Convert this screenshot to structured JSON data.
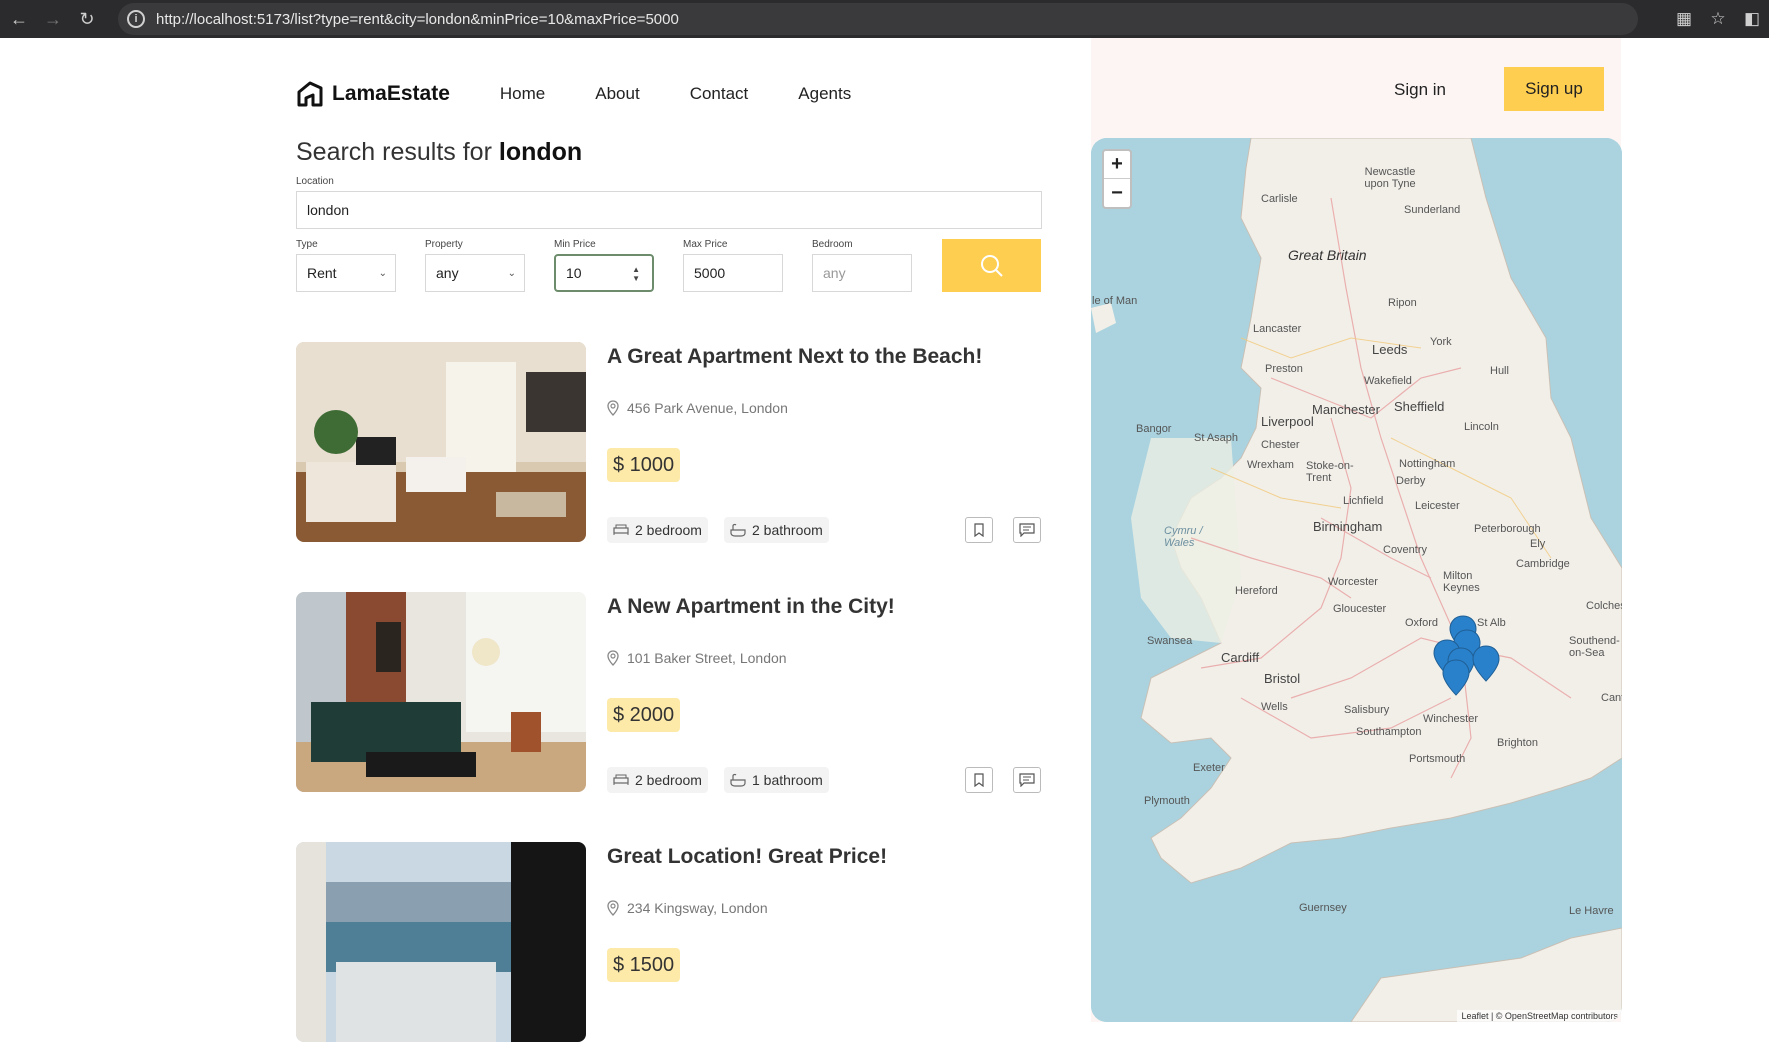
{
  "browser": {
    "url": "http://localhost:5173/list?type=rent&city=london&minPrice=10&maxPrice=5000"
  },
  "nav": {
    "brand": "LamaEstate",
    "links": [
      "Home",
      "About",
      "Contact",
      "Agents"
    ],
    "signin": "Sign in",
    "signup": "Sign up"
  },
  "search": {
    "title_prefix": "Search results for",
    "title_city": "london",
    "location_label": "Location",
    "location_value": "london",
    "type_label": "Type",
    "type_value": "Rent",
    "property_label": "Property",
    "property_value": "any",
    "min_label": "Min Price",
    "min_value": "10",
    "max_label": "Max Price",
    "max_value": "5000",
    "bedroom_label": "Bedroom",
    "bedroom_placeholder": "any"
  },
  "listings": [
    {
      "title": "A Great Apartment Next to the Beach!",
      "address": "456 Park Avenue, London",
      "price": "$ 1000",
      "bedroom": "2 bedroom",
      "bathroom": "2 bathroom"
    },
    {
      "title": "A New Apartment in the City!",
      "address": "101 Baker Street, London",
      "price": "$ 2000",
      "bedroom": "2 bedroom",
      "bathroom": "1 bathroom"
    },
    {
      "title": "Great Location! Great Price!",
      "address": "234 Kingsway, London",
      "price": "$ 1500",
      "bedroom": "",
      "bathroom": ""
    }
  ],
  "map": {
    "zoom_in": "+",
    "zoom_out": "−",
    "labels": {
      "great_britain": "Great Britain",
      "newcastle": "Newcastle upon Tyne",
      "carlisle": "Carlisle",
      "sunderland": "Sunderland",
      "isle_of_man": "le of Man",
      "ripon": "Ripon",
      "lancaster": "Lancaster",
      "leeds": "Leeds",
      "york": "York",
      "preston": "Preston",
      "wakefield": "Wakefield",
      "hull": "Hull",
      "manchester": "Manchester",
      "sheffield": "Sheffield",
      "liverpool": "Liverpool",
      "bangor": "Bangor",
      "st_asaph": "St Asaph",
      "chester": "Chester",
      "lincoln": "Lincoln",
      "wrexham": "Wrexham",
      "stoke": "Stoke-on-Trent",
      "nottingham": "Nottingham",
      "derby": "Derby",
      "lichfield": "Lichfield",
      "leicester": "Leicester",
      "birmingham": "Birmingham",
      "peterborough": "Peterborough",
      "cymru": "Cymru / Wales",
      "coventry": "Coventry",
      "ely": "Ely",
      "cambridge": "Cambridge",
      "milton_keynes": "Milton Keynes",
      "worcester": "Worcester",
      "hereford": "Hereford",
      "colchester": "Colches",
      "gloucester": "Gloucester",
      "oxford": "Oxford",
      "st_albans": "St Alb",
      "swansea": "Swansea",
      "cardiff": "Cardiff",
      "southend": "Southend-on-Sea",
      "bristol": "Bristol",
      "wells": "Wells",
      "salisbury": "Salisbury",
      "winchester": "Winchester",
      "southampton": "Southampton",
      "brighton": "Brighton",
      "canterbury": "Cant",
      "portsmouth": "Portsmouth",
      "exeter": "Exeter",
      "plymouth": "Plymouth",
      "guernsey": "Guernsey",
      "le_havre": "Le Havre"
    },
    "attribution": "Leaflet | © OpenStreetMap contributors"
  },
  "icons": {
    "brand": "house-logo-icon",
    "accent": "#fece51",
    "price_bg": "#fdeaa9"
  }
}
